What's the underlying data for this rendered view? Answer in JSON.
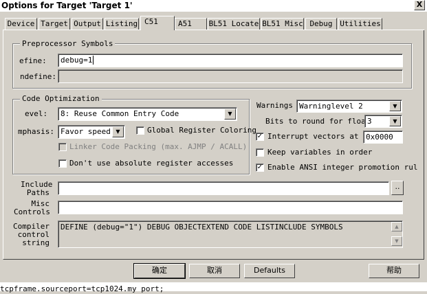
{
  "window": {
    "title": "Options for Target 'Target 1'",
    "close_glyph": "X"
  },
  "tabs": [
    {
      "label": "Device"
    },
    {
      "label": "Target"
    },
    {
      "label": "Output"
    },
    {
      "label": "Listing"
    },
    {
      "label": "C51"
    },
    {
      "label": "A51"
    },
    {
      "label": "BL51 Locate"
    },
    {
      "label": "BL51 Misc"
    },
    {
      "label": "Debug"
    },
    {
      "label": "Utilities"
    }
  ],
  "active_tab": "C51",
  "preprocessor": {
    "title": "Preprocessor Symbols",
    "define_label": "efine:",
    "define_value": "debug=1",
    "undefine_label": "ndefine:",
    "undefine_value": ""
  },
  "optimization": {
    "title": "Code Optimization",
    "level_label": "evel:",
    "level_value": "8: Reuse Common Entry Code",
    "emphasis_label": "mphasis:",
    "emphasis_value": "Favor speed",
    "global_register_label": "Global Register Coloring",
    "linker_packing_label": "Linker Code Packing (max. AJMP / ACALL)",
    "abs_register_label": "Don't use absolute register accesses"
  },
  "warnings": {
    "warnings_label": "Warnings",
    "warnings_value": "Warninglevel 2",
    "bits_label": "Bits to round for float",
    "bits_value": "3",
    "interrupt_label": "Interrupt vectors at a",
    "interrupt_value": "0x0000",
    "keep_vars_label": "Keep variables in order",
    "ansi_label": "Enable ANSI integer promotion rul"
  },
  "include": {
    "label_line1": "Include",
    "label_line2": "Paths",
    "value": "",
    "browse_label": ".."
  },
  "misc": {
    "label_line1": "Misc",
    "label_line2": "Controls",
    "value": ""
  },
  "compiler": {
    "label_line1": "Compiler",
    "label_line2": "control",
    "label_line3": "string",
    "value": "DEFINE (debug=\"1\") DEBUG OBJECTEXTEND CODE LISTINCLUDE SYMBOLS"
  },
  "buttons": {
    "ok": "确定",
    "cancel": "取消",
    "defaults": "Defaults",
    "help": "帮助"
  },
  "background_text": "tcpframe.sourceport=tcp1024.my port;"
}
